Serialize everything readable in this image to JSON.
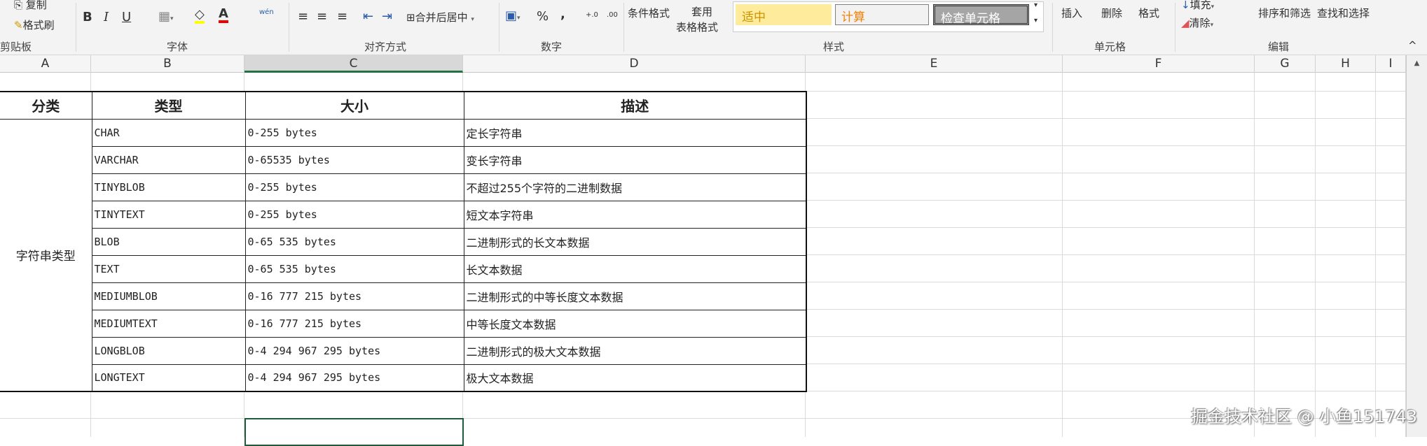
{
  "ribbon": {
    "clipboard": {
      "copy": "复制",
      "format_painter": "格式刷",
      "label": "剪贴板"
    },
    "font": {
      "bold": "B",
      "italic": "I",
      "underline": "U",
      "font_color": "A",
      "phonetic": "wén",
      "label": "字体"
    },
    "alignment": {
      "merge_center": "合并后居中",
      "label": "对齐方式"
    },
    "number": {
      "percent": "%",
      "comma": ",",
      "inc_decimal": "+.0",
      "dec_decimal": ".00",
      "label": "数字"
    },
    "styles": {
      "conditional": "条件格式",
      "table_format_1": "套用",
      "table_format_2": "表格格式",
      "neutral": "适中",
      "calculation": "计算",
      "check_cell": "检查单元格",
      "label": "样式"
    },
    "cells": {
      "insert": "插入",
      "delete": "删除",
      "format": "格式",
      "label": "单元格"
    },
    "editing": {
      "fill": "填充",
      "clear": "清除",
      "sort_filter": "排序和筛选",
      "find_select": "查找和选择",
      "label": "编辑"
    }
  },
  "columns": [
    "A",
    "B",
    "C",
    "D",
    "E",
    "F",
    "G",
    "H",
    "I"
  ],
  "table": {
    "headers": [
      "分类",
      "类型",
      "大小",
      "描述"
    ],
    "category": "字符串类型",
    "rows": [
      {
        "type": "CHAR",
        "size": "0-255 bytes",
        "desc": "定长字符串"
      },
      {
        "type": "VARCHAR",
        "size": "0-65535 bytes",
        "desc": "变长字符串"
      },
      {
        "type": "TINYBLOB",
        "size": "0-255 bytes",
        "desc": "不超过255个字符的二进制数据"
      },
      {
        "type": "TINYTEXT",
        "size": "0-255 bytes",
        "desc": "短文本字符串"
      },
      {
        "type": "BLOB",
        "size": "0-65 535 bytes",
        "desc": "二进制形式的长文本数据"
      },
      {
        "type": "TEXT",
        "size": "0-65 535 bytes",
        "desc": "长文本数据"
      },
      {
        "type": "MEDIUMBLOB",
        "size": "0-16 777 215 bytes",
        "desc": "二进制形式的中等长度文本数据"
      },
      {
        "type": "MEDIUMTEXT",
        "size": "0-16 777 215 bytes",
        "desc": "中等长度文本数据"
      },
      {
        "type": "LONGBLOB",
        "size": "0-4 294 967 295 bytes",
        "desc": "二进制形式的极大文本数据"
      },
      {
        "type": "LONGTEXT",
        "size": "0-4 294 967 295 bytes",
        "desc": "极大文本数据"
      }
    ]
  },
  "watermark": "掘金技术社区 @ 小鱼151743",
  "colors": {
    "accent": "#217346",
    "neutral_bg": "#ffeb9c",
    "neutral_fg": "#9c6500",
    "calc_fg": "#fa7d00",
    "check_bg": "#a5a5a5"
  }
}
